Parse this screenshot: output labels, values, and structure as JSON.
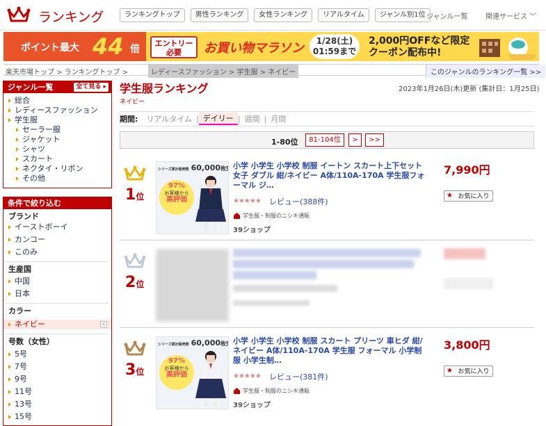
{
  "header": {
    "brand": "ランキング",
    "tabs": [
      "ランキングトップ",
      "男性ランキング",
      "女性ランキング",
      "リアルタイム",
      "ジャンル別1位"
    ],
    "genre_list": "ジャンル一覧",
    "related": "関連サービス ﹀"
  },
  "banner": {
    "point_label": "ポイント最大",
    "point_value": "44",
    "point_unit": "倍",
    "entry_line1": "エントリー",
    "entry_line2": "必要",
    "title": "お買い物マラソン",
    "date_line1": "1/28(土)",
    "date_line2": "01:59まで",
    "promo_line1": "2,000円OFFなど限定",
    "promo_line2": "クーポン配布中!"
  },
  "breadcrumb": {
    "path": "楽天市場トップ  >  ランキングトップ  >",
    "current": "レディースファッション  >  学生服  >  ネイビー",
    "genre_link": "このジャンルのランキング一覧 >>"
  },
  "sidebar": {
    "genre_header": "ジャンル一覧",
    "all_button": "全て見る",
    "genres": [
      "総合",
      "レディースファッション",
      "学生服"
    ],
    "subgenres": [
      "セーラー服",
      "ジャケット",
      "シャツ",
      "スカート",
      "ネクタイ・リボン",
      "その他"
    ],
    "filter_header": "条件で絞り込む",
    "brand_title": "ブランド",
    "brands": [
      "イーストボーイ",
      "カンコー",
      "このみ"
    ],
    "origin_title": "生産国",
    "origins": [
      "中国",
      "日本"
    ],
    "color_title": "カラー",
    "color_selected": "ネイビー",
    "color_remove": "×",
    "size_title": "号数（女性）",
    "sizes": [
      "5号",
      "7号",
      "9号",
      "11号",
      "13号",
      "15号"
    ]
  },
  "main": {
    "title": "学生服ランキング",
    "subtitle": "ネイビー",
    "updated": "2023年1月26日(木)更新 (集計日：1月25日)",
    "period_label": "期間:",
    "periods": [
      "リアルタイム",
      "デイリー",
      "週間",
      "月間"
    ],
    "period_active": "デイリー",
    "pager": {
      "current": "1-80位",
      "next_range": "81-104位",
      "next": ">",
      "last": ">>"
    }
  },
  "items": [
    {
      "rank": "1",
      "rank_suffix": "位",
      "title": "小学 小学生 小学校 制服 イートン スカート上下セット 女子 ダブル 紺/ネイビー A体/110A-170A 学生服フォーマル ジ…",
      "price": "7,990円",
      "rating": 4.5,
      "stars": "★★★★★",
      "review": "レビュー(388件)",
      "shop": "学生服・制服のニシキ通販",
      "ship": "39ショップ",
      "fav": "お気に入り",
      "thumb_badge_small": "シリーズ累計販売数",
      "thumb_badge": "60,000",
      "thumb_badge_suffix": "枚突破",
      "thumb_pct": "97%",
      "thumb_line": "お客様から",
      "thumb_eval": "高評価"
    },
    {
      "rank": "2",
      "rank_suffix": "位"
    },
    {
      "rank": "3",
      "rank_suffix": "位",
      "title": "小学 小学生 小学校 制服 スカート プリーツ 車ヒダ 紺/ネイビー A体/110A-170A 学生服 フォーマル 小学制服 小学生制…",
      "price": "3,800円",
      "rating": 4.5,
      "stars": "★★★★★",
      "review": "レビュー(381件)",
      "shop": "学生服・制服のニシキ通販",
      "ship": "39ショップ",
      "fav": "お気に入り",
      "thumb_badge_small": "シリーズ累計販売数",
      "thumb_badge": "60,000",
      "thumb_badge_suffix": "枚突破",
      "thumb_pct": "97%",
      "thumb_line": "お客様から",
      "thumb_eval": "高評価"
    }
  ],
  "colors": {
    "accent": "#bf0000",
    "gold": "#e8b410",
    "silver": "#c0c8d8",
    "bronze": "#b08850"
  }
}
